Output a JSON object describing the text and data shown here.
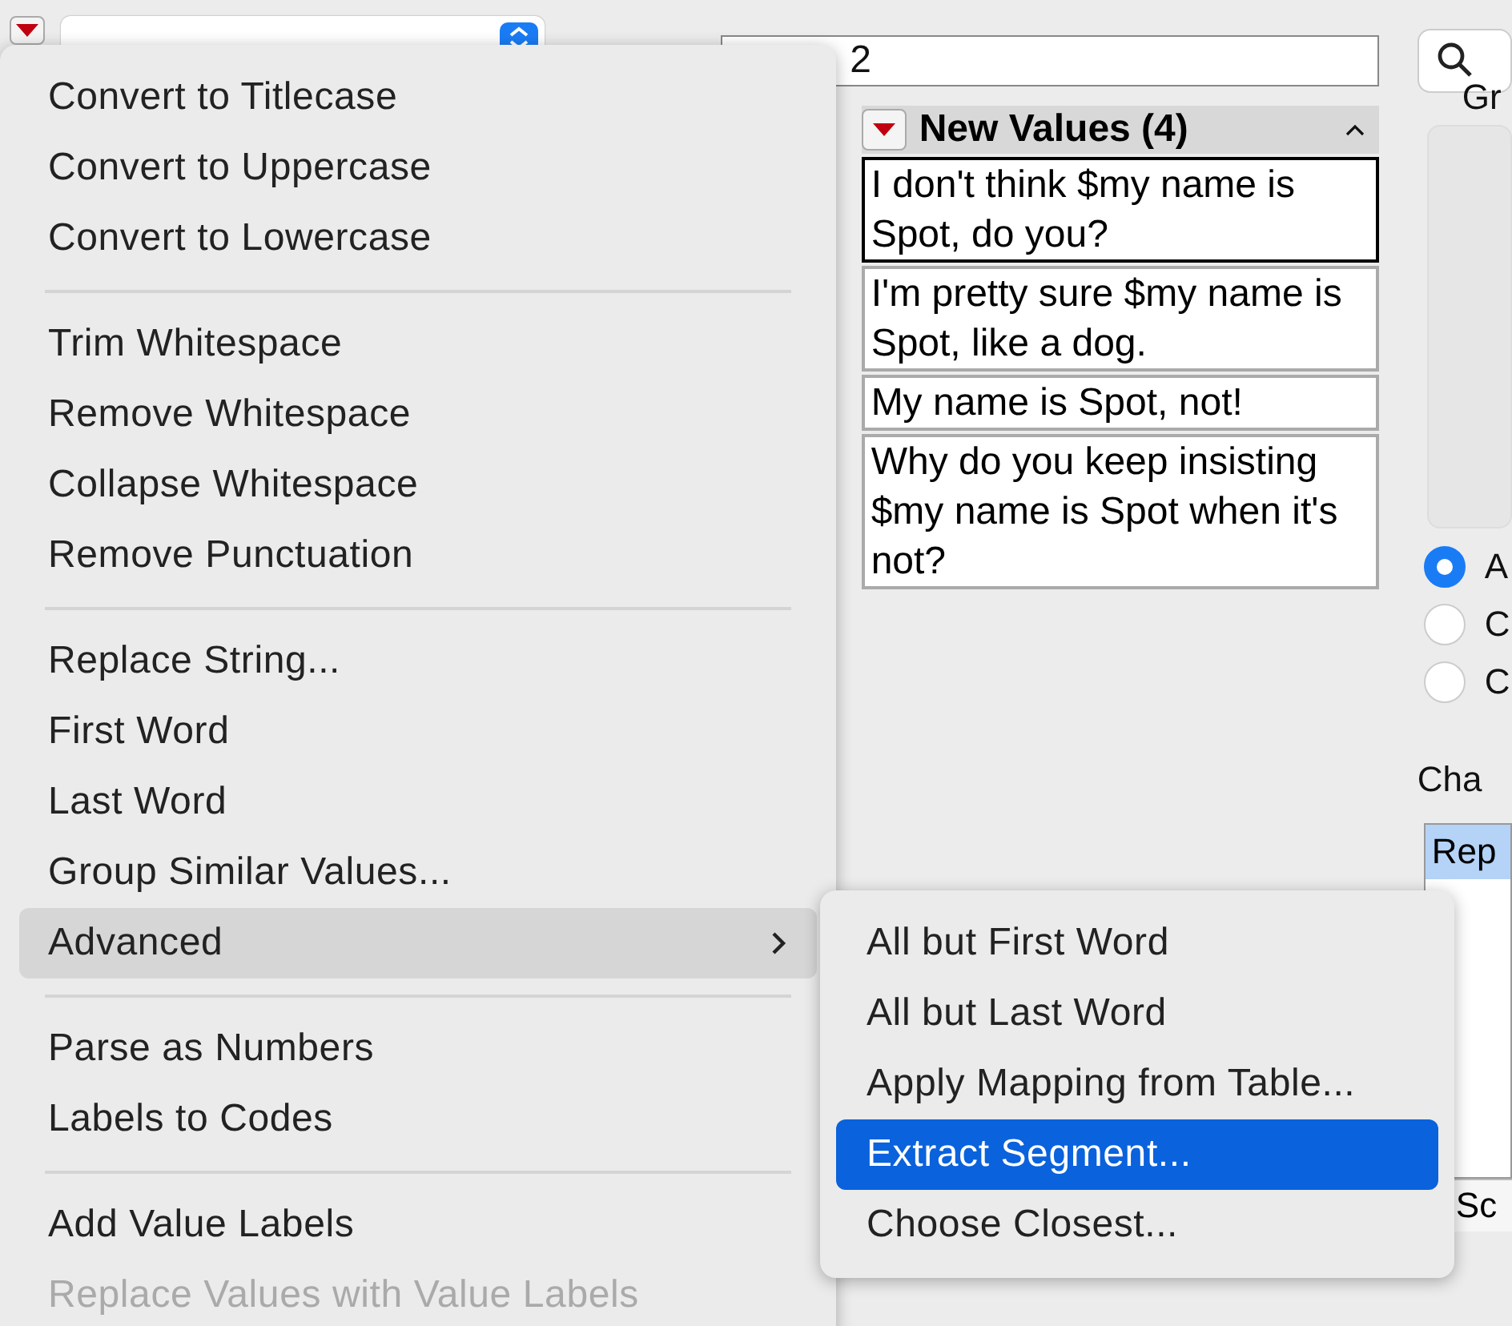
{
  "toolbar": {
    "field_value": "2"
  },
  "values_panel": {
    "title": "New Values (4)",
    "rows": [
      {
        "text": "I don't think $my name is Spot, do you?",
        "selected": true
      },
      {
        "text": "I'm pretty sure $my name is Spot, like a dog.",
        "selected": false
      },
      {
        "text": "My name is Spot, not!",
        "selected": false
      },
      {
        "text": "Why do you keep insisting $my name is Spot when it's not?",
        "selected": false
      }
    ]
  },
  "right_pane": {
    "group_label": "Gr",
    "radios": [
      {
        "label": "A",
        "selected": true
      },
      {
        "label": "C",
        "selected": false
      },
      {
        "label": "C",
        "selected": false
      }
    ],
    "list_label": "Cha",
    "list_items": [
      {
        "text": "Rep",
        "selected": true
      }
    ],
    "footer_label": "Sc"
  },
  "menu": {
    "sections": [
      [
        {
          "label": "Convert to Titlecase",
          "highlighted": false,
          "disabled": false,
          "submenu": false
        },
        {
          "label": "Convert to Uppercase",
          "highlighted": false,
          "disabled": false,
          "submenu": false
        },
        {
          "label": "Convert to Lowercase",
          "highlighted": false,
          "disabled": false,
          "submenu": false
        }
      ],
      [
        {
          "label": "Trim Whitespace",
          "highlighted": false,
          "disabled": false,
          "submenu": false
        },
        {
          "label": "Remove Whitespace",
          "highlighted": false,
          "disabled": false,
          "submenu": false
        },
        {
          "label": "Collapse Whitespace",
          "highlighted": false,
          "disabled": false,
          "submenu": false
        },
        {
          "label": "Remove Punctuation",
          "highlighted": false,
          "disabled": false,
          "submenu": false
        }
      ],
      [
        {
          "label": "Replace String...",
          "highlighted": false,
          "disabled": false,
          "submenu": false
        },
        {
          "label": "First Word",
          "highlighted": false,
          "disabled": false,
          "submenu": false
        },
        {
          "label": "Last Word",
          "highlighted": false,
          "disabled": false,
          "submenu": false
        },
        {
          "label": "Group Similar Values...",
          "highlighted": false,
          "disabled": false,
          "submenu": false
        },
        {
          "label": "Advanced",
          "highlighted": true,
          "disabled": false,
          "submenu": true
        }
      ],
      [
        {
          "label": "Parse as Numbers",
          "highlighted": false,
          "disabled": false,
          "submenu": false
        },
        {
          "label": "Labels to Codes",
          "highlighted": false,
          "disabled": false,
          "submenu": false
        }
      ],
      [
        {
          "label": "Add Value Labels",
          "highlighted": false,
          "disabled": false,
          "submenu": false
        },
        {
          "label": "Replace Values with Value Labels",
          "highlighted": false,
          "disabled": true,
          "submenu": false
        }
      ]
    ]
  },
  "submenu": {
    "items": [
      {
        "label": "All but First Word",
        "selected": false
      },
      {
        "label": "All but Last Word",
        "selected": false
      },
      {
        "label": "Apply Mapping from Table...",
        "selected": false
      },
      {
        "label": "Extract Segment...",
        "selected": true
      },
      {
        "label": "Choose Closest...",
        "selected": false
      }
    ]
  }
}
